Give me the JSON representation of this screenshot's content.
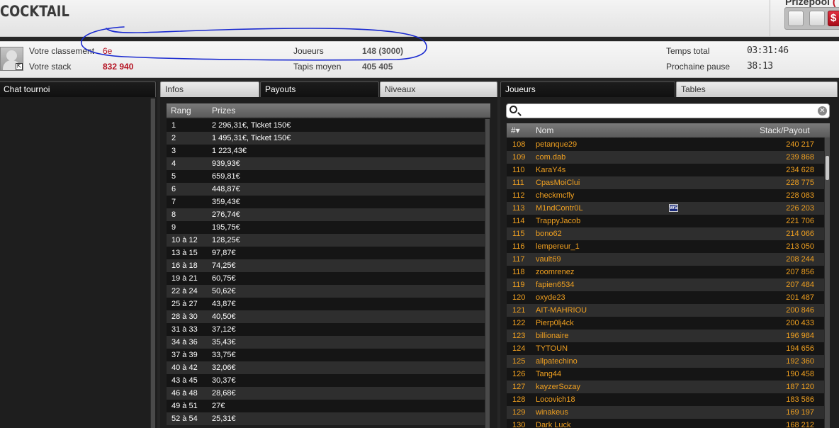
{
  "app": {
    "title": "COCKTAIL"
  },
  "prizepool": {
    "label": "Prizepool",
    "suffix": "(",
    "button_glyph": "$"
  },
  "stats": {
    "rank_label": "Votre classement",
    "rank_value": "6e",
    "stack_label": "Votre stack",
    "stack_value": "832 940",
    "players_label": "Joueurs",
    "players_value": "148 (3000)",
    "avg_label": "Tapis moyen",
    "avg_value": "405 405",
    "total_label": "Temps total",
    "total_value": "03:31:46",
    "pause_label": "Prochaine pause",
    "pause_value": "38:13"
  },
  "colors": {
    "accent_red": "#b41020",
    "player_orange": "#f0a020",
    "scribble_blue": "#1a2ad0"
  },
  "chat": {
    "tab_label": "Chat tournoi"
  },
  "middle": {
    "tabs": [
      "Infos",
      "Payouts",
      "Niveaux"
    ],
    "active_tab": "Payouts",
    "headers": {
      "rank": "Rang",
      "prize": "Prizes"
    },
    "rows": [
      [
        "1",
        "2 296,31€, Ticket 150€"
      ],
      [
        "2",
        "1 495,31€, Ticket 150€"
      ],
      [
        "3",
        "1 223,43€"
      ],
      [
        "4",
        "939,93€"
      ],
      [
        "5",
        "659,81€"
      ],
      [
        "6",
        "448,87€"
      ],
      [
        "7",
        "359,43€"
      ],
      [
        "8",
        "276,74€"
      ],
      [
        "9",
        "195,75€"
      ],
      [
        "10 à 12",
        "128,25€"
      ],
      [
        "13 à 15",
        "97,87€"
      ],
      [
        "16 à 18",
        "74,25€"
      ],
      [
        "19 à 21",
        "60,75€"
      ],
      [
        "22 à 24",
        "50,62€"
      ],
      [
        "25 à 27",
        "43,87€"
      ],
      [
        "28 à 30",
        "40,50€"
      ],
      [
        "31 à 33",
        "37,12€"
      ],
      [
        "34 à 36",
        "35,43€"
      ],
      [
        "37 à 39",
        "33,75€"
      ],
      [
        "40 à 42",
        "32,06€"
      ],
      [
        "43 à 45",
        "30,37€"
      ],
      [
        "46 à 48",
        "28,68€"
      ],
      [
        "49 à 51",
        "27€"
      ],
      [
        "52 à 54",
        "25,31€"
      ]
    ]
  },
  "players": {
    "tabs": [
      "Joueurs",
      "Tables"
    ],
    "active_tab": "Joueurs",
    "search_placeholder": "",
    "headers": {
      "num": "#▾",
      "name": "Nom",
      "stack": "Stack/Payout"
    },
    "badge_text": "WS",
    "rows": [
      [
        "108",
        "petanque29",
        "240 217",
        false
      ],
      [
        "109",
        "com.dab",
        "239 868",
        false
      ],
      [
        "110",
        "KaraY4s",
        "234 628",
        false
      ],
      [
        "111",
        "CpasMoiClui",
        "228 775",
        false
      ],
      [
        "112",
        "checkmcfly",
        "228 083",
        false
      ],
      [
        "113",
        "M1ndContr0L",
        "226 203",
        true
      ],
      [
        "114",
        "TrappyJacob",
        "221 706",
        false
      ],
      [
        "115",
        "bono62",
        "214 066",
        false
      ],
      [
        "116",
        "lempereur_1",
        "213 050",
        false
      ],
      [
        "117",
        "vault69",
        "208 244",
        false
      ],
      [
        "118",
        "zoomrenez",
        "207 856",
        false
      ],
      [
        "119",
        "fapien6534",
        "207 484",
        false
      ],
      [
        "120",
        "oxyde23",
        "201 487",
        false
      ],
      [
        "121",
        "AIT-MAHRIOU",
        "200 846",
        false
      ],
      [
        "122",
        "Pierp0lj4ck",
        "200 433",
        false
      ],
      [
        "123",
        "billionaire",
        "196 984",
        false
      ],
      [
        "124",
        "TYTOUN",
        "194 656",
        false
      ],
      [
        "125",
        "allpatechino",
        "192 360",
        false
      ],
      [
        "126",
        "Tang44",
        "190 458",
        false
      ],
      [
        "127",
        "kayzerSozay",
        "187 120",
        false
      ],
      [
        "128",
        "Locovich18",
        "183 586",
        false
      ],
      [
        "129",
        "winakeus",
        "169 197",
        false
      ],
      [
        "130",
        "Dark Luck",
        "168 212",
        false
      ]
    ]
  }
}
